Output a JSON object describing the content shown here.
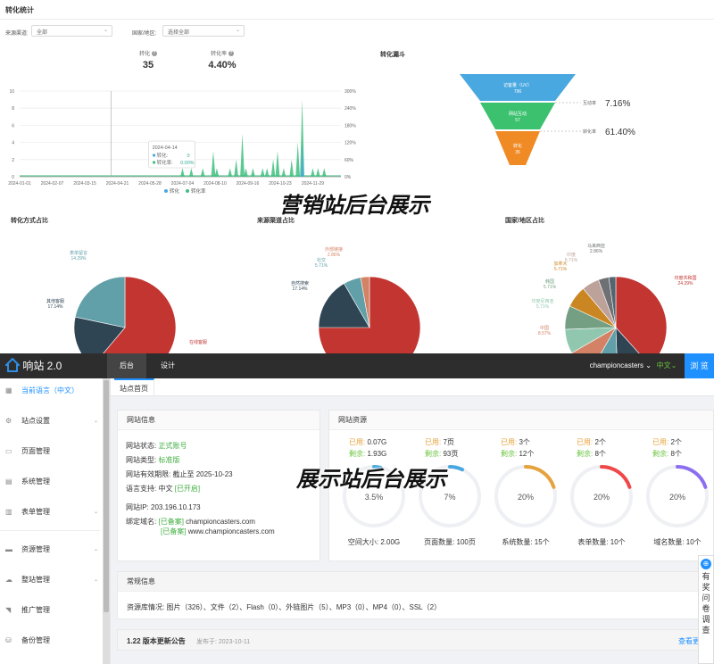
{
  "stats": {
    "title": "转化统计",
    "filter_source_label": "来源渠道:",
    "filter_source_value": "全部",
    "filter_country_label": "国家/地区:",
    "filter_country_value": "选择全部",
    "kpi": [
      {
        "label": "转化",
        "value": "35"
      },
      {
        "label": "转化率",
        "value": "4.40%"
      }
    ],
    "tooltip": {
      "date": "2024-04-14",
      "conv_label": "转化:",
      "conv_value": "0",
      "rate_label": "转化率:",
      "rate_value": "0.00%"
    },
    "legend": [
      "转化",
      "转化率"
    ],
    "funnel": {
      "title": "转化漏斗",
      "stages": [
        {
          "name": "访客量（UV）",
          "value": "796",
          "color": "#4aa8e0"
        },
        {
          "name": "网站互动",
          "value": "57",
          "color": "#3cc16f"
        },
        {
          "name": "转化",
          "value": "35",
          "color": "#f08a24"
        }
      ],
      "rates": [
        {
          "label": "互动率",
          "value": "7.16%"
        },
        {
          "label": "转化率",
          "value": "61.40%"
        }
      ]
    },
    "pies": [
      {
        "title": "转化方式占比",
        "labels": [
          {
            "name": "表单留言",
            "pct": "14.29%"
          },
          {
            "name": "其他客服",
            "pct": "17.14%"
          },
          {
            "name": "在线客服",
            "pct": ""
          }
        ]
      },
      {
        "title": "来源渠道占比",
        "labels": [
          {
            "name": "外部链接",
            "pct": "2.86%"
          },
          {
            "name": "社交",
            "pct": "5.71%"
          },
          {
            "name": "自然搜索",
            "pct": "17.14%"
          }
        ]
      },
      {
        "title": "国家/地区占比",
        "labels": [
          {
            "name": "马来西亚",
            "pct": "2.86%"
          },
          {
            "name": "印度",
            "pct": "5.71%"
          },
          {
            "name": "加拿大",
            "pct": "5.71%"
          },
          {
            "name": "韩国",
            "pct": "5.71%"
          },
          {
            "name": "印度尼西亚",
            "pct": "5.71%"
          },
          {
            "name": "中国",
            "pct": "8.57%"
          },
          {
            "name": "印度共和国",
            "pct": "24.29%"
          }
        ]
      }
    ],
    "overlay": "营销站后台展示"
  },
  "chart_data": {
    "type": "area",
    "x_ticks": [
      "2024-01-01",
      "2024-02-07",
      "2024-03-15",
      "2024-04-21",
      "2024-05-28",
      "2024-07-04",
      "2024-08-10",
      "2024-09-16",
      "2024-10-23",
      "2024-11-29"
    ],
    "y_ticks": [
      "0",
      "2",
      "4",
      "6",
      "8",
      "10"
    ],
    "y2_ticks": [
      "0%",
      "60%",
      "120%",
      "180%",
      "240%",
      "300%"
    ],
    "ylim": [
      0,
      10
    ],
    "series": [
      {
        "name": "转化",
        "color": "#4aa8e0"
      },
      {
        "name": "转化率",
        "color": "#3fbf7f"
      }
    ],
    "peaks": [
      {
        "date": "2024-07-04",
        "value": 1
      },
      {
        "date": "2024-07-14",
        "value": 1
      },
      {
        "date": "2024-07-27",
        "value": 1
      },
      {
        "date": "2024-08-08",
        "value": 3
      },
      {
        "date": "2024-08-12",
        "value": 1
      },
      {
        "date": "2024-08-27",
        "value": 1
      },
      {
        "date": "2024-09-03",
        "value": 2
      },
      {
        "date": "2024-09-10",
        "value": 5
      },
      {
        "date": "2024-09-14",
        "value": 1
      },
      {
        "date": "2024-09-22",
        "value": 1
      },
      {
        "date": "2024-10-03",
        "value": 1
      },
      {
        "date": "2024-10-08",
        "value": 1
      },
      {
        "date": "2024-10-15",
        "value": 2
      },
      {
        "date": "2024-10-20",
        "value": 3
      },
      {
        "date": "2024-10-27",
        "value": 1
      },
      {
        "date": "2024-11-05",
        "value": 2
      },
      {
        "date": "2024-11-12",
        "value": 4
      },
      {
        "date": "2024-11-17",
        "value": 9
      },
      {
        "date": "2024-11-29",
        "value": 1
      },
      {
        "date": "2024-12-05",
        "value": 1
      },
      {
        "date": "2024-12-12",
        "value": 1
      }
    ]
  },
  "admin": {
    "logo": "响站 2.0",
    "nav": [
      "后台",
      "设计"
    ],
    "user": "championcasters",
    "lang": "中文",
    "browse": "浏 览",
    "sidebar": [
      "当前语言（中文）",
      "站点设置",
      "页面管理",
      "系统管理",
      "表单管理",
      "资源管理",
      "整站管理",
      "推广管理",
      "备份管理"
    ],
    "tab": "站点首页",
    "site_info": {
      "title": "网站信息",
      "status_k": "网站状态:",
      "status_v": "正式账号",
      "type_k": "网站类型:",
      "type_v": "标准版",
      "valid_k": "网站有效期限:",
      "valid_v": "截止至 2025-10-23",
      "lang_k": "语言支持:",
      "lang_v": "中文",
      "lang_tag": "[已开启]",
      "ip_k": "网站IP:",
      "ip_v": "203.196.10.173",
      "domain_k": "绑定域名:",
      "domain_tag": "[已备案]",
      "domains": [
        "championcasters.com",
        "www.championcasters.com"
      ]
    },
    "resources": {
      "title": "网站资源",
      "used_label": "已用:",
      "left_label": "剩余:",
      "items": [
        {
          "used": "0.07G",
          "left": "1.93G",
          "pct": "3.5%",
          "fill": 0.035,
          "color": "#4aa8e0",
          "name": "空间大小: 2.00G"
        },
        {
          "used": "7页",
          "left": "93页",
          "pct": "7%",
          "fill": 0.07,
          "color": "#4aa8e0",
          "name": "页面数量: 100页"
        },
        {
          "used": "3个",
          "left": "12个",
          "pct": "20%",
          "fill": 0.2,
          "color": "#e6a23c",
          "name": "系统数量: 15个"
        },
        {
          "used": "2个",
          "left": "8个",
          "pct": "20%",
          "fill": 0.2,
          "color": "#f04848",
          "name": "表单数量: 10个"
        },
        {
          "used": "2个",
          "left": "8个",
          "pct": "20%",
          "fill": 0.2,
          "color": "#8c6ff0",
          "name": "域名数量: 10个"
        }
      ]
    },
    "common": {
      "title": "常规信息",
      "text": "资源库情况: 图片（326）、文件（2）、Flash（0）、外链图片（5）、MP3（0）、MP4（0）、SSL（2）"
    },
    "update": {
      "title": "1.22 版本更新公告",
      "date": "发布于: 2023-10-11",
      "link": "查看更"
    },
    "survey": [
      "有",
      "奖",
      "问",
      "卷",
      "调",
      "查"
    ],
    "overlay": "展示站后台展示"
  }
}
